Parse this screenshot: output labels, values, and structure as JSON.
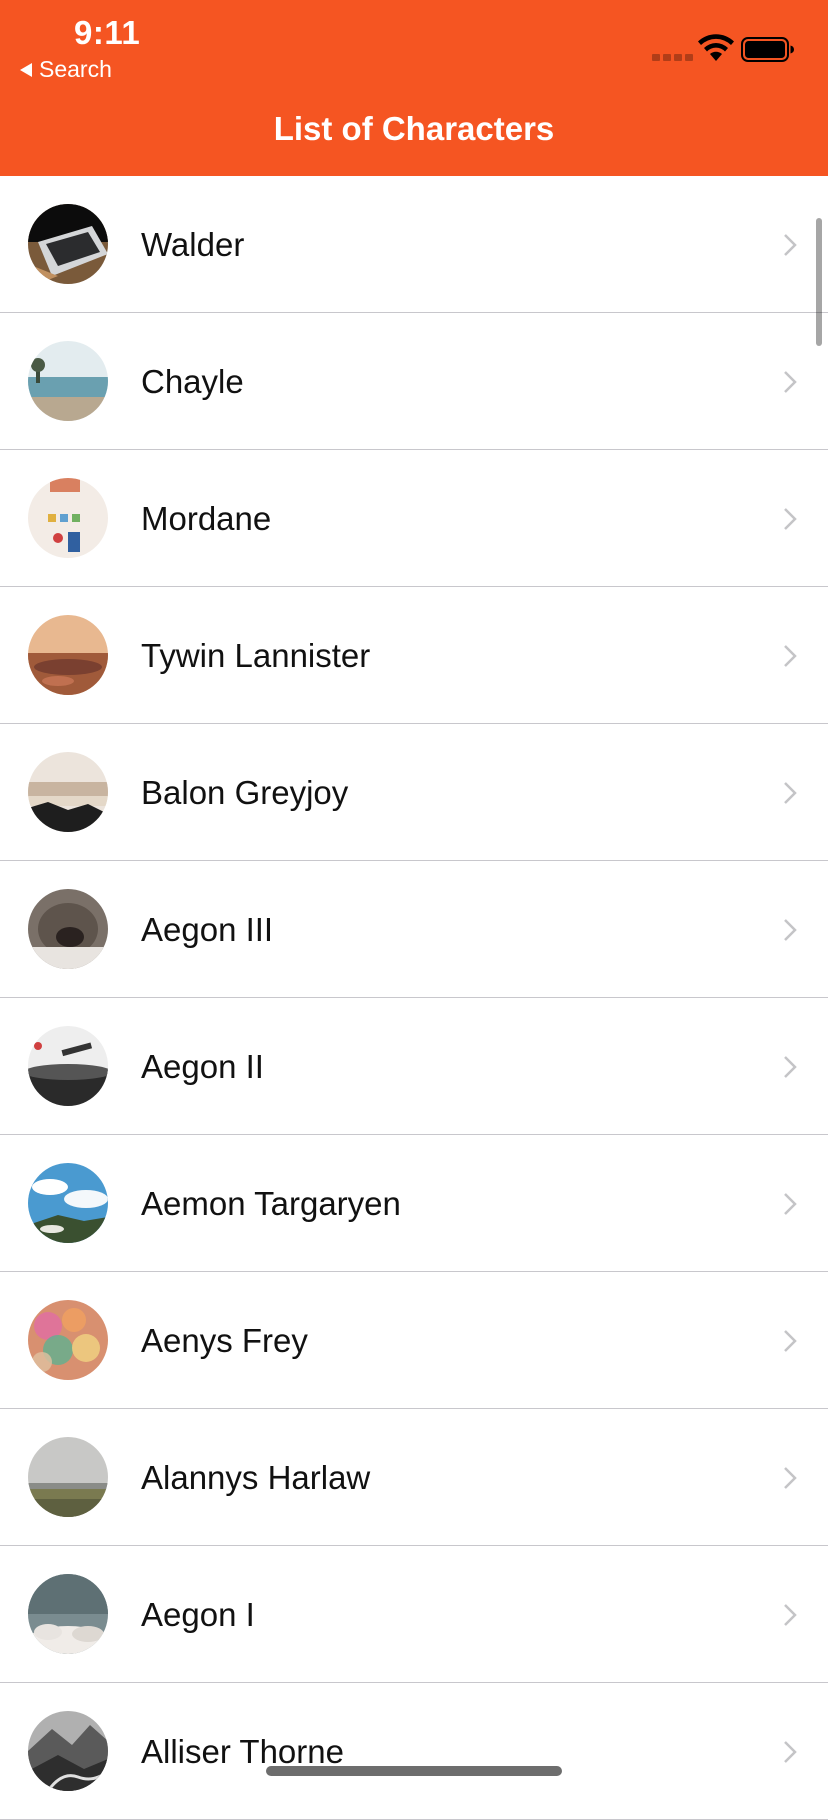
{
  "status_bar": {
    "time": "9:11",
    "back_label": "Search"
  },
  "nav": {
    "title": "List of Characters"
  },
  "colors": {
    "header": "#f55522",
    "separator": "#c8c7cc",
    "chevron": "#c4c4c7"
  },
  "characters": [
    {
      "name": "Walder",
      "avatar": "laptop-photo"
    },
    {
      "name": "Chayle",
      "avatar": "beach-photo"
    },
    {
      "name": "Mordane",
      "avatar": "desk-items-photo"
    },
    {
      "name": "Tywin Lannister",
      "avatar": "desert-photo"
    },
    {
      "name": "Balon Greyjoy",
      "avatar": "rocky-shore-photo"
    },
    {
      "name": "Aegon III",
      "avatar": "cat-nose-photo"
    },
    {
      "name": "Aegon II",
      "avatar": "turntable-photo"
    },
    {
      "name": "Aemon Targaryen",
      "avatar": "sky-clouds-photo"
    },
    {
      "name": "Aenys Frey",
      "avatar": "bokeh-lights-photo"
    },
    {
      "name": "Alannys Harlaw",
      "avatar": "misty-field-photo"
    },
    {
      "name": "Aegon I",
      "avatar": "cloud-sky-photo"
    },
    {
      "name": "Alliser Thorne",
      "avatar": "mountain-bw-photo"
    }
  ]
}
